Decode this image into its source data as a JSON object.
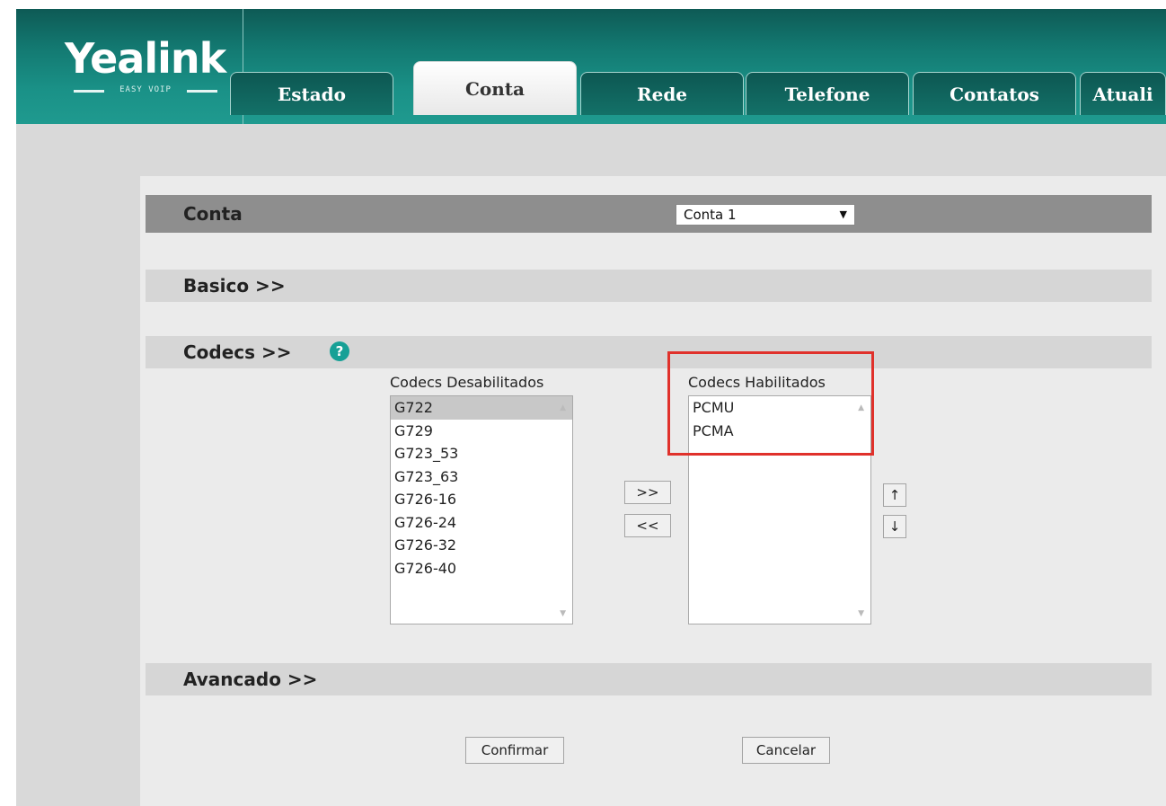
{
  "brand": {
    "logo": "Yealink",
    "tagline": "EASY VOIP"
  },
  "nav": {
    "tabs": [
      {
        "label": "Estado",
        "active": false
      },
      {
        "label": "Conta",
        "active": true
      },
      {
        "label": "Rede",
        "active": false
      },
      {
        "label": "Telefone",
        "active": false
      },
      {
        "label": "Contatos",
        "active": false
      },
      {
        "label": "Atuali",
        "active": false
      }
    ]
  },
  "account": {
    "label": "Conta",
    "selected": "Conta 1"
  },
  "sections": {
    "basic": "Basico >>",
    "codecs": "Codecs >>",
    "advanced": "Avancado >>"
  },
  "codecs": {
    "disabled_label": "Codecs Desabilitados",
    "enabled_label": "Codecs Habilitados",
    "disabled": [
      "G722",
      "G729",
      "G723_53",
      "G723_63",
      "G726-16",
      "G726-24",
      "G726-32",
      "G726-40"
    ],
    "enabled": [
      "PCMU",
      "PCMA"
    ],
    "add_label": ">>",
    "remove_label": "<<",
    "up_label": "↑",
    "down_label": "↓"
  },
  "actions": {
    "confirm": "Confirmar",
    "cancel": "Cancelar"
  },
  "colors": {
    "header": "#137a72",
    "highlight_box": "#e0312b",
    "help": "#17a096"
  }
}
